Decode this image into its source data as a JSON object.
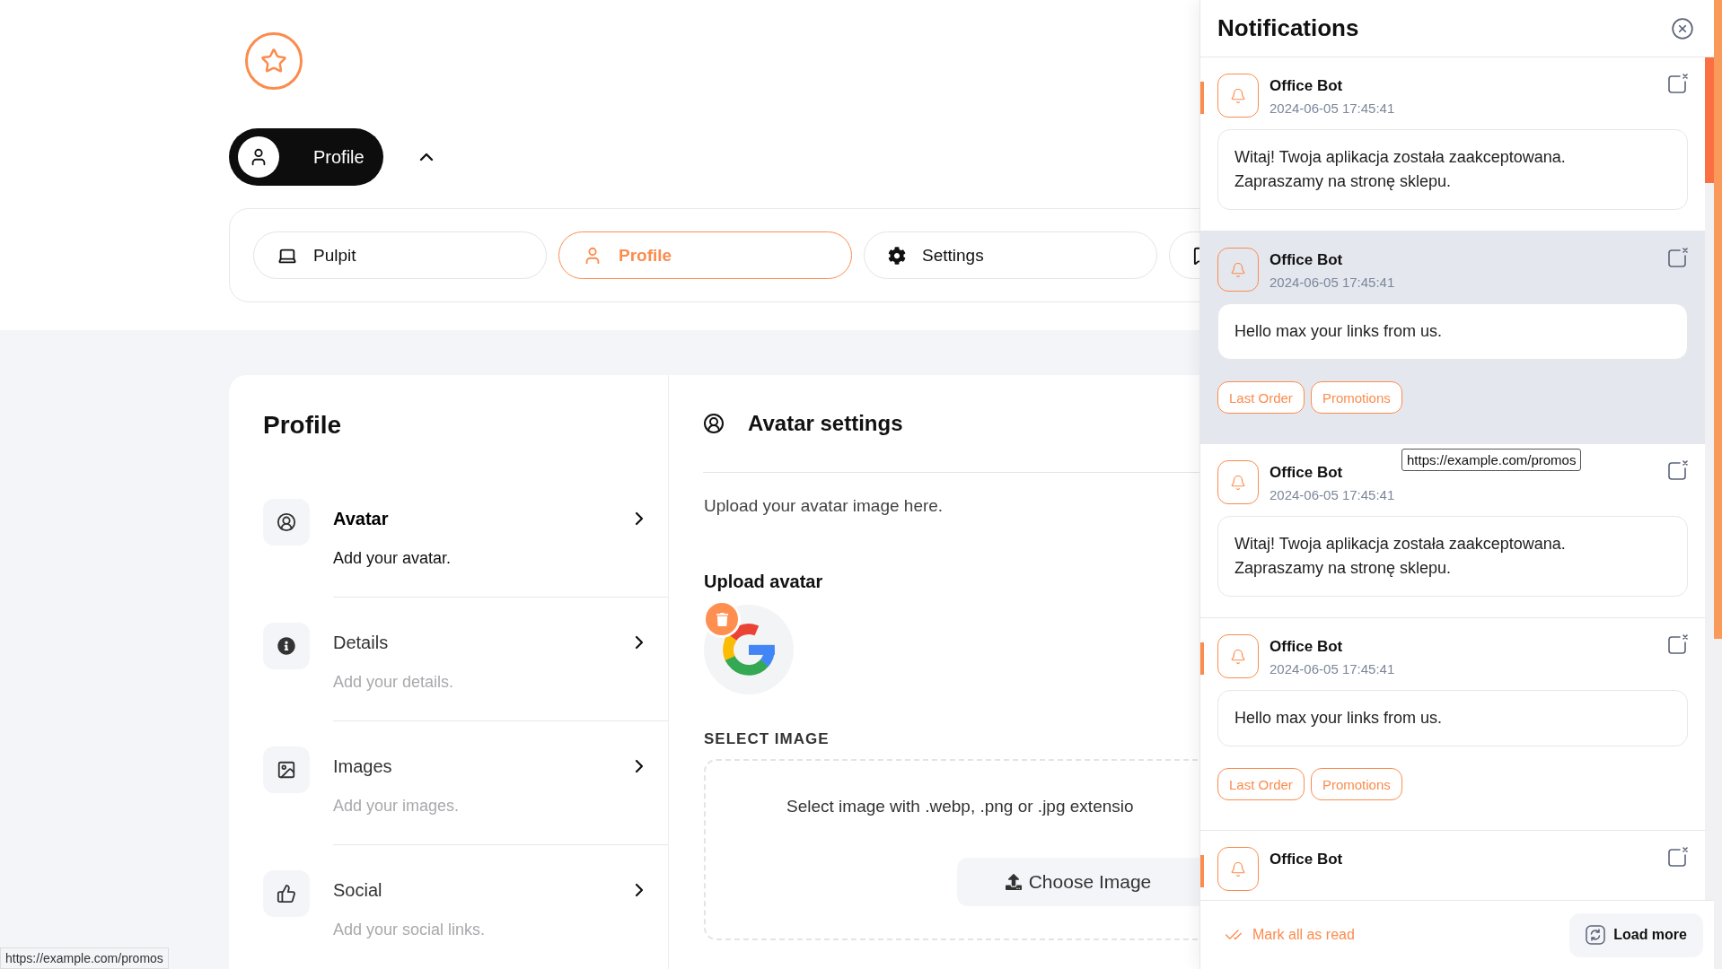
{
  "profile_menu": {
    "label": "Profile",
    "expanded": true
  },
  "tabs": [
    {
      "label": "Pulpit",
      "selected": false
    },
    {
      "label": "Profile",
      "selected": true
    },
    {
      "label": "Settings",
      "selected": false
    },
    {
      "selected": false
    }
  ],
  "profile_panel": {
    "title": "Profile",
    "items": [
      {
        "title": "Avatar",
        "description": "Add your avatar.",
        "selected": true
      },
      {
        "title": "Details",
        "description": "Add your details.",
        "selected": false
      },
      {
        "title": "Images",
        "description": "Add your images.",
        "selected": false
      },
      {
        "title": "Social",
        "description": "Add your social links.",
        "selected": false
      }
    ]
  },
  "avatar_settings": {
    "title": "Avatar settings",
    "description": "Upload your avatar image here.",
    "upload_label": "Upload avatar",
    "select_label": "SELECT IMAGE",
    "dropzone_text": "Select image with .webp, .png or .jpg extensio",
    "choose_button": "Choose Image"
  },
  "notifications": {
    "title": "Notifications",
    "items": [
      {
        "sender": "Office Bot",
        "date": "2024-06-05 17:45:41",
        "message": "Witaj! Twoja aplikacja została zaakceptowana. Zapraszamy na stronę sklepu.",
        "unread": true,
        "hovered": false
      },
      {
        "sender": "Office Bot",
        "date": "2024-06-05 17:45:41",
        "message": "Hello max your links from us.",
        "unread": false,
        "hovered": true,
        "tags": [
          "Last Order",
          "Promotions"
        ]
      },
      {
        "sender": "Office Bot",
        "date": "2024-06-05 17:45:41",
        "message": "Witaj! Twoja aplikacja została zaakceptowana. Zapraszamy na stronę sklepu.",
        "unread": false,
        "hovered": false
      },
      {
        "sender": "Office Bot",
        "date": "2024-06-05 17:45:41",
        "message": "Hello max your links from us.",
        "unread": true,
        "hovered": false,
        "tags": [
          "Last Order",
          "Promotions"
        ]
      },
      {
        "sender": "Office Bot",
        "unread": true,
        "hovered": false
      }
    ],
    "mark_all": "Mark all as read",
    "load_more": "Load more"
  },
  "tooltip": "https://example.com/promos",
  "status_bar": "https://example.com/promos"
}
